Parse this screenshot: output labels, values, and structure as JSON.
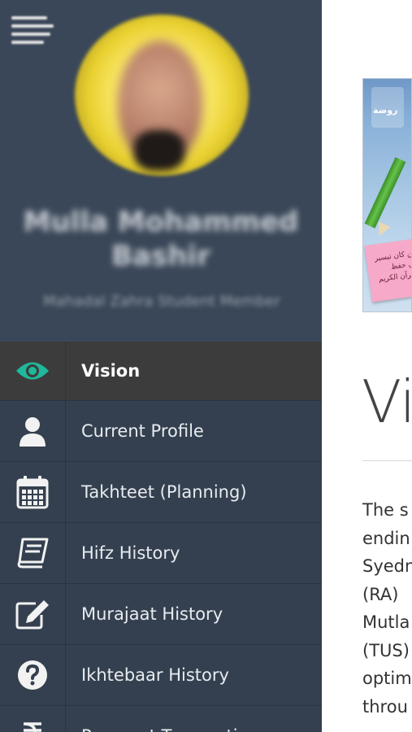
{
  "content": {
    "title": "Vi",
    "paragraph_lines": [
      "The s",
      "endin",
      "Syedn",
      "(RA)",
      "Mutla",
      "(TUS)",
      "optim",
      "throu"
    ],
    "banner": {
      "logo_text": "روضة",
      "note_text": "من كان تيسير في حفظ القرآن الكريم"
    }
  },
  "drawer": {
    "profile": {
      "name_line1": "Mulla Mohammed",
      "name_line2": "Bashir",
      "subtitle": "Mahadal Zahra Student Member"
    },
    "menu": [
      {
        "label": "Vision",
        "icon": "eye-icon",
        "active": true
      },
      {
        "label": "Current Profile",
        "icon": "user-icon",
        "active": false
      },
      {
        "label": "Takhteet (Planning)",
        "icon": "calendar-icon",
        "active": false
      },
      {
        "label": "Hifz History",
        "icon": "book-icon",
        "active": false
      },
      {
        "label": "Murajaat History",
        "icon": "edit-icon",
        "active": false
      },
      {
        "label": "Ikhtebaar History",
        "icon": "question-icon",
        "active": false
      },
      {
        "label": "Payment Transactions",
        "icon": "rupee-icon",
        "active": false
      }
    ]
  },
  "colors": {
    "accent": "#1fb89a",
    "drawer_bg": "#34404f",
    "active_bg": "#3c3c3c"
  }
}
